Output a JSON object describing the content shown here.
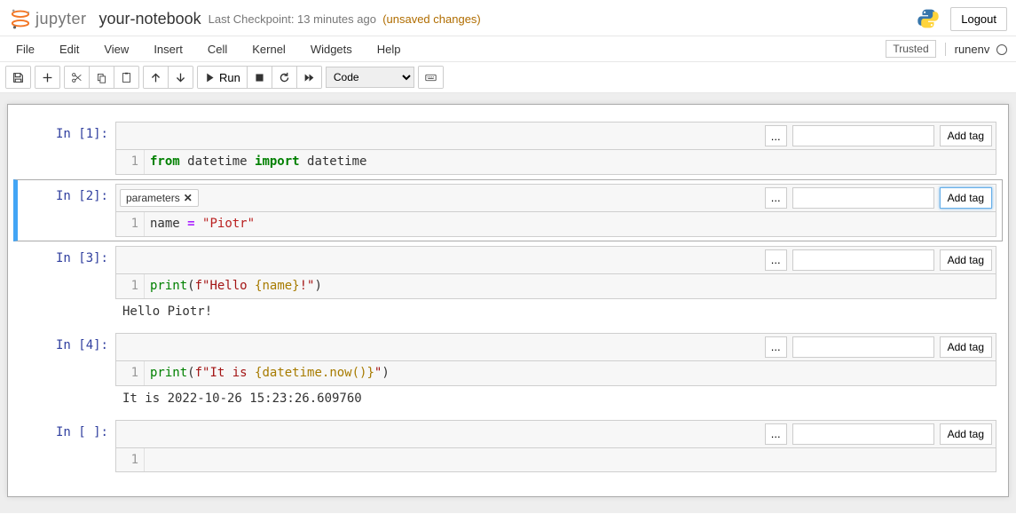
{
  "header": {
    "logo_text": "jupyter",
    "notebook_name": "your-notebook",
    "checkpoint": "Last Checkpoint: 13 minutes ago",
    "unsaved": "(unsaved changes)",
    "logout": "Logout"
  },
  "menubar": {
    "items": [
      "File",
      "Edit",
      "View",
      "Insert",
      "Cell",
      "Kernel",
      "Widgets",
      "Help"
    ],
    "trusted": "Trusted",
    "kernel_name": "runenv"
  },
  "toolbar": {
    "run_label": "Run",
    "cell_type_selected": "Code",
    "icons": {
      "save": "save-icon",
      "add": "plus-icon",
      "cut": "scissors-icon",
      "copy": "copy-icon",
      "paste": "paste-icon",
      "up": "arrow-up-icon",
      "down": "arrow-down-icon",
      "run": "play-icon",
      "stop": "stop-icon",
      "restart": "restart-icon",
      "ff": "fast-forward-icon",
      "cmd": "keyboard-icon"
    }
  },
  "cells": [
    {
      "prompt": "In [1]:",
      "tags": [],
      "code_tokens": [
        [
          "kw-green",
          "from"
        ],
        [
          "",
          ""
        ],
        [
          "name-tok",
          " datetime "
        ],
        [
          "kw-green",
          "import"
        ],
        [
          "name-tok",
          " datetime"
        ]
      ],
      "code_raw": "from datetime import datetime",
      "output": null,
      "selected": false,
      "dots": "...",
      "addtag": "Add tag",
      "line": "1"
    },
    {
      "prompt": "In [2]:",
      "tags": [
        "parameters"
      ],
      "code_raw": "name = \"Piotr\"",
      "output": null,
      "selected": true,
      "dots": "...",
      "addtag": "Add tag",
      "line": "1"
    },
    {
      "prompt": "In [3]:",
      "tags": [],
      "code_raw": "print(f\"Hello {name}!\")",
      "output": "Hello Piotr!",
      "selected": false,
      "dots": "...",
      "addtag": "Add tag",
      "line": "1"
    },
    {
      "prompt": "In [4]:",
      "tags": [],
      "code_raw": "print(f\"It is {datetime.now()}\")",
      "output": "It is 2022-10-26 15:23:26.609760",
      "selected": false,
      "dots": "...",
      "addtag": "Add tag",
      "line": "1"
    },
    {
      "prompt": "In [ ]:",
      "tags": [],
      "code_raw": "",
      "output": null,
      "selected": false,
      "dots": "...",
      "addtag": "Add tag",
      "line": "1"
    }
  ],
  "tag_close": "✕"
}
